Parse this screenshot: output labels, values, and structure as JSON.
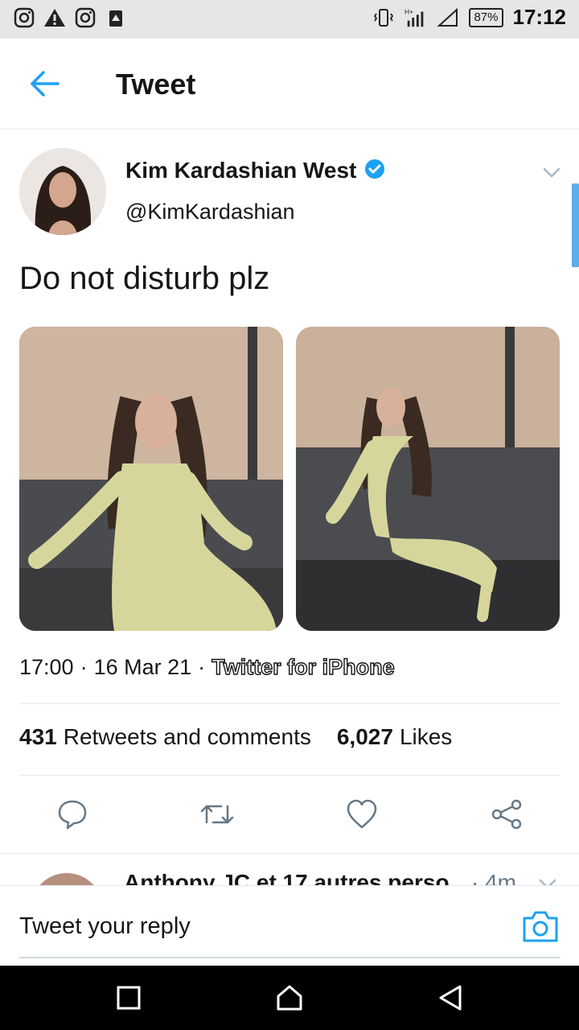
{
  "status_bar": {
    "battery": "87%",
    "time": "17:12",
    "left_icons": [
      "instagram-icon",
      "warning-icon",
      "instagram-icon",
      "download-icon"
    ],
    "right_icons": [
      "vibrate-icon",
      "signal-icon",
      "wifi-icon"
    ]
  },
  "header": {
    "title": "Tweet",
    "back_icon": "arrow-left-icon"
  },
  "tweet": {
    "name": "Kim Kardashian West",
    "handle": "@KimKardashian",
    "text": "Do not disturb plz",
    "time": "17:00",
    "date": "16 Mar 21",
    "separator": "·",
    "source": "Twitter for iPhone",
    "retweets_count": "431",
    "retweets_label": "Retweets and comments",
    "likes_count": "6,027",
    "likes_label": "Likes"
  },
  "next_reply": {
    "text": "Anthony JC et 17 autres perso...",
    "time": "· 4m"
  },
  "reply_bar": {
    "placeholder": "Tweet your reply"
  },
  "colors": {
    "accent": "#1da1f2",
    "text": "#14171a",
    "divider": "#e1e8ed"
  }
}
